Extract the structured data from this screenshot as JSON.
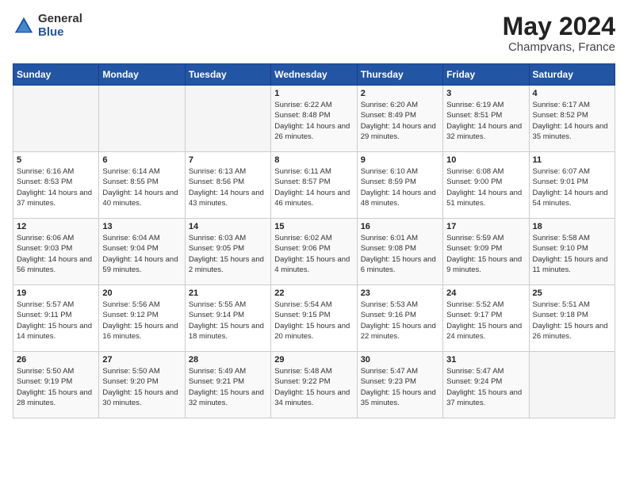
{
  "logo": {
    "general": "General",
    "blue": "Blue"
  },
  "title": {
    "month_year": "May 2024",
    "location": "Champvans, France"
  },
  "weekdays": [
    "Sunday",
    "Monday",
    "Tuesday",
    "Wednesday",
    "Thursday",
    "Friday",
    "Saturday"
  ],
  "weeks": [
    [
      {
        "day": "",
        "sunrise": "",
        "sunset": "",
        "daylight": ""
      },
      {
        "day": "",
        "sunrise": "",
        "sunset": "",
        "daylight": ""
      },
      {
        "day": "",
        "sunrise": "",
        "sunset": "",
        "daylight": ""
      },
      {
        "day": "1",
        "sunrise": "Sunrise: 6:22 AM",
        "sunset": "Sunset: 8:48 PM",
        "daylight": "Daylight: 14 hours and 26 minutes."
      },
      {
        "day": "2",
        "sunrise": "Sunrise: 6:20 AM",
        "sunset": "Sunset: 8:49 PM",
        "daylight": "Daylight: 14 hours and 29 minutes."
      },
      {
        "day": "3",
        "sunrise": "Sunrise: 6:19 AM",
        "sunset": "Sunset: 8:51 PM",
        "daylight": "Daylight: 14 hours and 32 minutes."
      },
      {
        "day": "4",
        "sunrise": "Sunrise: 6:17 AM",
        "sunset": "Sunset: 8:52 PM",
        "daylight": "Daylight: 14 hours and 35 minutes."
      }
    ],
    [
      {
        "day": "5",
        "sunrise": "Sunrise: 6:16 AM",
        "sunset": "Sunset: 8:53 PM",
        "daylight": "Daylight: 14 hours and 37 minutes."
      },
      {
        "day": "6",
        "sunrise": "Sunrise: 6:14 AM",
        "sunset": "Sunset: 8:55 PM",
        "daylight": "Daylight: 14 hours and 40 minutes."
      },
      {
        "day": "7",
        "sunrise": "Sunrise: 6:13 AM",
        "sunset": "Sunset: 8:56 PM",
        "daylight": "Daylight: 14 hours and 43 minutes."
      },
      {
        "day": "8",
        "sunrise": "Sunrise: 6:11 AM",
        "sunset": "Sunset: 8:57 PM",
        "daylight": "Daylight: 14 hours and 46 minutes."
      },
      {
        "day": "9",
        "sunrise": "Sunrise: 6:10 AM",
        "sunset": "Sunset: 8:59 PM",
        "daylight": "Daylight: 14 hours and 48 minutes."
      },
      {
        "day": "10",
        "sunrise": "Sunrise: 6:08 AM",
        "sunset": "Sunset: 9:00 PM",
        "daylight": "Daylight: 14 hours and 51 minutes."
      },
      {
        "day": "11",
        "sunrise": "Sunrise: 6:07 AM",
        "sunset": "Sunset: 9:01 PM",
        "daylight": "Daylight: 14 hours and 54 minutes."
      }
    ],
    [
      {
        "day": "12",
        "sunrise": "Sunrise: 6:06 AM",
        "sunset": "Sunset: 9:03 PM",
        "daylight": "Daylight: 14 hours and 56 minutes."
      },
      {
        "day": "13",
        "sunrise": "Sunrise: 6:04 AM",
        "sunset": "Sunset: 9:04 PM",
        "daylight": "Daylight: 14 hours and 59 minutes."
      },
      {
        "day": "14",
        "sunrise": "Sunrise: 6:03 AM",
        "sunset": "Sunset: 9:05 PM",
        "daylight": "Daylight: 15 hours and 2 minutes."
      },
      {
        "day": "15",
        "sunrise": "Sunrise: 6:02 AM",
        "sunset": "Sunset: 9:06 PM",
        "daylight": "Daylight: 15 hours and 4 minutes."
      },
      {
        "day": "16",
        "sunrise": "Sunrise: 6:01 AM",
        "sunset": "Sunset: 9:08 PM",
        "daylight": "Daylight: 15 hours and 6 minutes."
      },
      {
        "day": "17",
        "sunrise": "Sunrise: 5:59 AM",
        "sunset": "Sunset: 9:09 PM",
        "daylight": "Daylight: 15 hours and 9 minutes."
      },
      {
        "day": "18",
        "sunrise": "Sunrise: 5:58 AM",
        "sunset": "Sunset: 9:10 PM",
        "daylight": "Daylight: 15 hours and 11 minutes."
      }
    ],
    [
      {
        "day": "19",
        "sunrise": "Sunrise: 5:57 AM",
        "sunset": "Sunset: 9:11 PM",
        "daylight": "Daylight: 15 hours and 14 minutes."
      },
      {
        "day": "20",
        "sunrise": "Sunrise: 5:56 AM",
        "sunset": "Sunset: 9:12 PM",
        "daylight": "Daylight: 15 hours and 16 minutes."
      },
      {
        "day": "21",
        "sunrise": "Sunrise: 5:55 AM",
        "sunset": "Sunset: 9:14 PM",
        "daylight": "Daylight: 15 hours and 18 minutes."
      },
      {
        "day": "22",
        "sunrise": "Sunrise: 5:54 AM",
        "sunset": "Sunset: 9:15 PM",
        "daylight": "Daylight: 15 hours and 20 minutes."
      },
      {
        "day": "23",
        "sunrise": "Sunrise: 5:53 AM",
        "sunset": "Sunset: 9:16 PM",
        "daylight": "Daylight: 15 hours and 22 minutes."
      },
      {
        "day": "24",
        "sunrise": "Sunrise: 5:52 AM",
        "sunset": "Sunset: 9:17 PM",
        "daylight": "Daylight: 15 hours and 24 minutes."
      },
      {
        "day": "25",
        "sunrise": "Sunrise: 5:51 AM",
        "sunset": "Sunset: 9:18 PM",
        "daylight": "Daylight: 15 hours and 26 minutes."
      }
    ],
    [
      {
        "day": "26",
        "sunrise": "Sunrise: 5:50 AM",
        "sunset": "Sunset: 9:19 PM",
        "daylight": "Daylight: 15 hours and 28 minutes."
      },
      {
        "day": "27",
        "sunrise": "Sunrise: 5:50 AM",
        "sunset": "Sunset: 9:20 PM",
        "daylight": "Daylight: 15 hours and 30 minutes."
      },
      {
        "day": "28",
        "sunrise": "Sunrise: 5:49 AM",
        "sunset": "Sunset: 9:21 PM",
        "daylight": "Daylight: 15 hours and 32 minutes."
      },
      {
        "day": "29",
        "sunrise": "Sunrise: 5:48 AM",
        "sunset": "Sunset: 9:22 PM",
        "daylight": "Daylight: 15 hours and 34 minutes."
      },
      {
        "day": "30",
        "sunrise": "Sunrise: 5:47 AM",
        "sunset": "Sunset: 9:23 PM",
        "daylight": "Daylight: 15 hours and 35 minutes."
      },
      {
        "day": "31",
        "sunrise": "Sunrise: 5:47 AM",
        "sunset": "Sunset: 9:24 PM",
        "daylight": "Daylight: 15 hours and 37 minutes."
      },
      {
        "day": "",
        "sunrise": "",
        "sunset": "",
        "daylight": ""
      }
    ]
  ]
}
